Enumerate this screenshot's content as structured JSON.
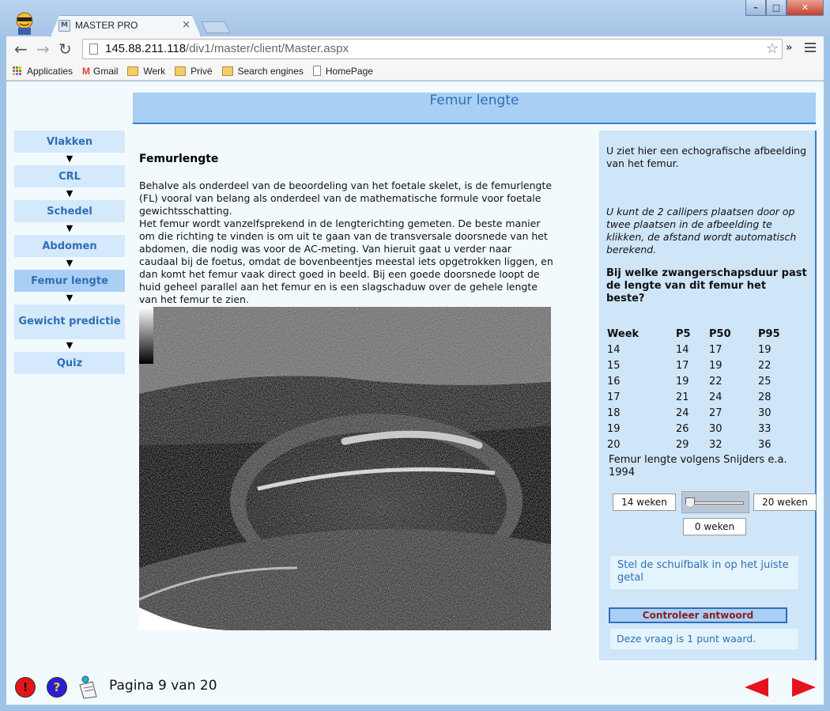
{
  "browser": {
    "tab_title": "MASTER PRO",
    "favicon_letter": "M",
    "url_host": "145.88.211.118",
    "url_path": "/div1/master/client/Master.aspx",
    "bookmarks": [
      "Applicaties",
      "Gmail",
      "Werk",
      "Privé",
      "Search engines",
      "HomePage"
    ]
  },
  "header": {
    "title": "Femur lengte"
  },
  "nav": {
    "items": [
      "Vlakken",
      "CRL",
      "Schedel",
      "Abdomen",
      "Femur lengte",
      "Gewicht predictie",
      "Quiz"
    ],
    "active": "Femur lengte"
  },
  "content": {
    "heading": "Femurlengte",
    "paragraph1": "Behalve als onderdeel van de beoordeling van het foetale skelet, is de femurlengte (FL) vooral van belang als onderdeel van de mathematische formule voor foetale gewichtsschatting.",
    "paragraph2": "Het femur wordt vanzelfsprekend in de lengterichting gemeten. De beste manier om die richting te vinden is om uit te gaan van de transversale doorsnede van het abdomen, die nodig was voor de AC-meting. Van hieruit gaat u verder naar caudaal bij de foetus, omdat de bovenbeentjes meestal iets opgetrokken liggen, en dan komt het femur vaak direct goed in beeld. Bij een goede doorsnede loopt de huid geheel parallel aan het femur en is een slagschaduw over de gehele lengte van het femur te zien."
  },
  "side": {
    "intro": "U ziet hier een echografische afbeelding van het femur.",
    "instruction": " U kunt de 2 callipers plaatsen door op twee plaatsen in de afbeelding te klikken, de afstand wordt automatisch berekend.",
    "question": "Bij welke zwangerschapsduur past de lengte van dit femur het beste?",
    "table_headers": [
      "Week",
      "P5",
      "P50",
      "P95"
    ],
    "table_rows": [
      [
        "14",
        "14",
        "17",
        "19"
      ],
      [
        "15",
        "17",
        "19",
        "22"
      ],
      [
        "16",
        "19",
        "22",
        "25"
      ],
      [
        "17",
        "21",
        "24",
        "28"
      ],
      [
        "18",
        "24",
        "27",
        "30"
      ],
      [
        "19",
        "26",
        "30",
        "33"
      ],
      [
        "20",
        "29",
        "32",
        "36"
      ]
    ],
    "source": "Femur lengte volgens Snijders e.a. 1994",
    "slider_min_label": "14 weken",
    "slider_max_label": "20 weken",
    "slider_value_label": "0 weken",
    "slider_fraction": 0,
    "hint": "Stel de schuifbalk in op het juiste getal",
    "check_button": "Controleer antwoord",
    "points": "Deze vraag is 1 punt waard."
  },
  "footer": {
    "page_label": "Pagina 9 van 20"
  }
}
